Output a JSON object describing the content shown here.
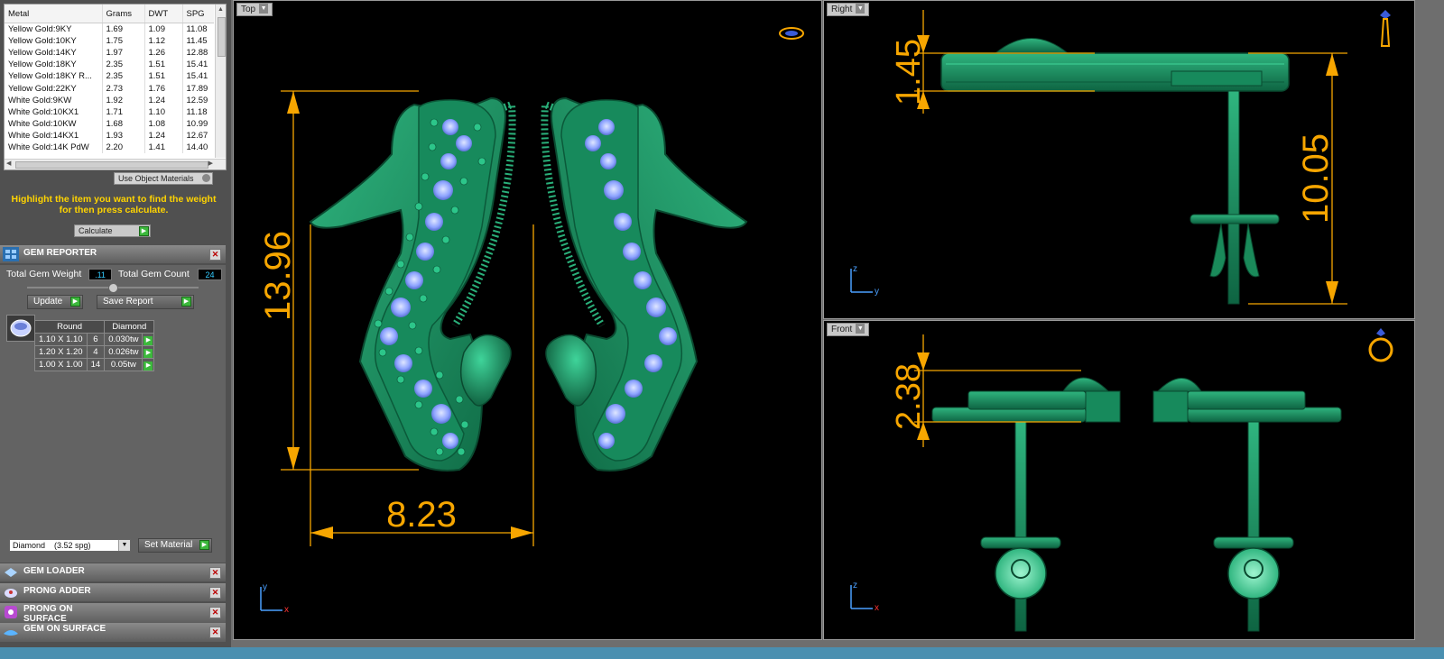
{
  "metal_table": {
    "headers": [
      "Metal",
      "Grams",
      "DWT",
      "SPG"
    ],
    "rows": [
      [
        "Yellow Gold:9KY",
        "1.69",
        "1.09",
        "11.08"
      ],
      [
        "Yellow Gold:10KY",
        "1.75",
        "1.12",
        "11.45"
      ],
      [
        "Yellow Gold:14KY",
        "1.97",
        "1.26",
        "12.88"
      ],
      [
        "Yellow Gold:18KY",
        "2.35",
        "1.51",
        "15.41"
      ],
      [
        "Yellow Gold:18KY R...",
        "2.35",
        "1.51",
        "15.41"
      ],
      [
        "Yellow Gold:22KY",
        "2.73",
        "1.76",
        "17.89"
      ],
      [
        "White Gold:9KW",
        "1.92",
        "1.24",
        "12.59"
      ],
      [
        "White Gold:10KX1",
        "1.71",
        "1.10",
        "11.18"
      ],
      [
        "White Gold:10KW",
        "1.68",
        "1.08",
        "10.99"
      ],
      [
        "White Gold:14KX1",
        "1.93",
        "1.24",
        "12.67"
      ],
      [
        "White Gold:14K PdW",
        "2.20",
        "1.41",
        "14.40"
      ]
    ]
  },
  "use_object_materials": "Use Object Materials",
  "instruction": "Highlight the item you want to find the weight for then press calculate.",
  "calculate": "Calculate",
  "gem_reporter": {
    "title": "GEM REPORTER",
    "total_weight_label": "Total Gem Weight",
    "total_weight": ".11",
    "total_count_label": "Total Gem Count",
    "total_count": "24",
    "update": "Update",
    "save_report": "Save Report",
    "gems_header": [
      "Round",
      "Diamond"
    ],
    "gems": [
      [
        "1.10 X 1.10",
        "6",
        "0.030tw"
      ],
      [
        "1.20 X 1.20",
        "4",
        "0.026tw"
      ],
      [
        "1.00 X 1.00",
        "14",
        "0.05tw"
      ]
    ],
    "material_select": "Diamond    (3.52 spg)",
    "set_material": "Set Material"
  },
  "panels": [
    {
      "title": "GEM LOADER"
    },
    {
      "title": "PRONG ADDER"
    },
    {
      "title": "PRONG ON SURFACE"
    },
    {
      "title": "GEM ON SURFACE"
    }
  ],
  "viewports": {
    "top": {
      "label": "Top",
      "height_dim": "13.96",
      "width_dim": "8.23",
      "axis_v": "y",
      "axis_h": "x"
    },
    "right": {
      "label": "Right",
      "dim_small": "1.45",
      "dim_tall": "10.05",
      "axis_v": "z",
      "axis_h": "y"
    },
    "front": {
      "label": "Front",
      "dim": "2.38",
      "axis_v": "z",
      "axis_h": "x"
    }
  },
  "colors": {
    "dimension": "#f7a600",
    "model_green": "#1f8f63",
    "gem_blue": "#8ea4ff",
    "instruction": "#ffd400"
  }
}
